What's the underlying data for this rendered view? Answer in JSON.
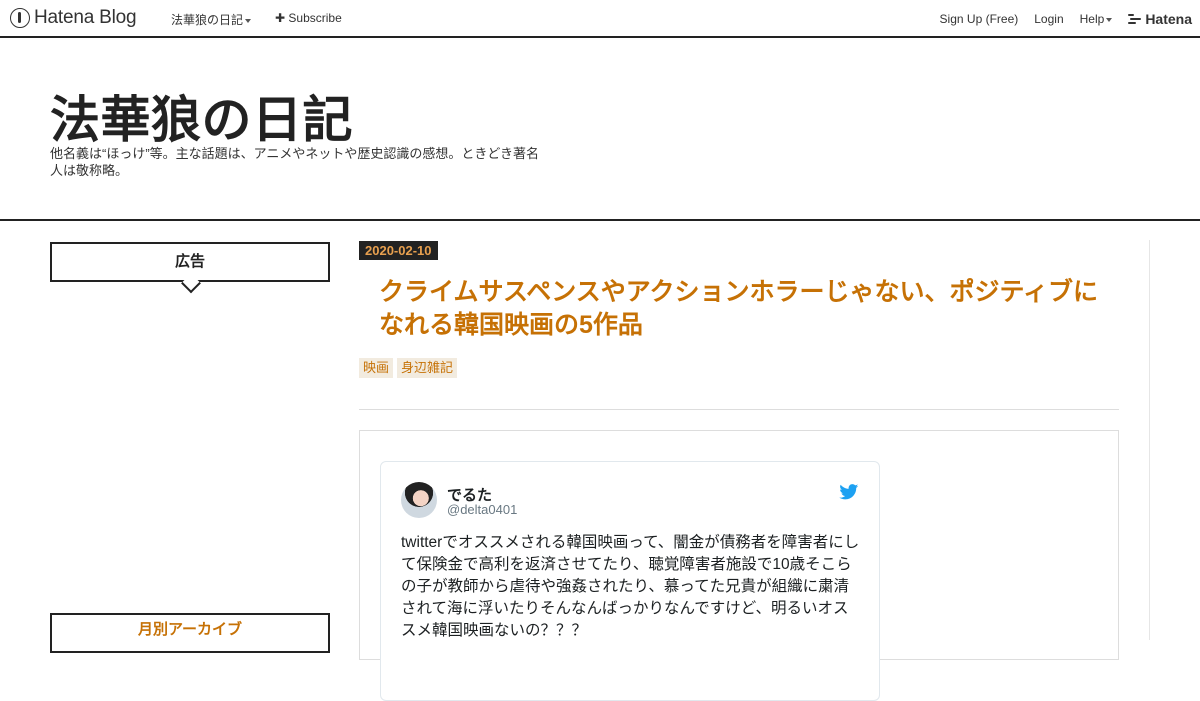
{
  "topbar": {
    "logo_text": "Hatena Blog",
    "blog_menu": "法華狼の日記",
    "subscribe": "Subscribe",
    "sign_up": "Sign Up (Free)",
    "login": "Login",
    "help": "Help",
    "hatena": "Hatena"
  },
  "header": {
    "title": "法華狼の日記",
    "description": "他名義は“ほっけ”等。主な話題は、アニメやネットや歴史認識の感想。ときどき著名人は敬称略。"
  },
  "sidebar": {
    "ad_heading": "広告",
    "archive_heading": "月別アーカイブ"
  },
  "entry": {
    "date": "2020-02-10",
    "title": "クライムサスペンスやアクションホラーじゃない、ポジティブになれる韓国映画の5作品",
    "tags": [
      "映画",
      "身辺雑記"
    ]
  },
  "tweet": {
    "name": "でるた",
    "handle": "@delta0401",
    "text": "twitterでオススメされる韓国映画って、闇金が債務者を障害者にして保険金で高利を返済させてたり、聴覚障害者施設で10歳そこらの子が教師から虐待や強姦されたり、慕ってた兄貴が組織に粛清されて海に浮いたりそんなんばっかりなんですけど、明るいオススメ韓国映画ないの？？？"
  },
  "colors": {
    "accent": "#c67105",
    "date_text": "#e8a04f",
    "tag_bg": "#f2ebdf",
    "twitter_blue": "#1da1f2"
  },
  "icons": {
    "hatena_blog_logo": "hatena-blog-logo-icon",
    "subscribe_plus": "plus-icon",
    "dropdown": "caret-down-icon",
    "twitter": "twitter-bird-icon"
  }
}
